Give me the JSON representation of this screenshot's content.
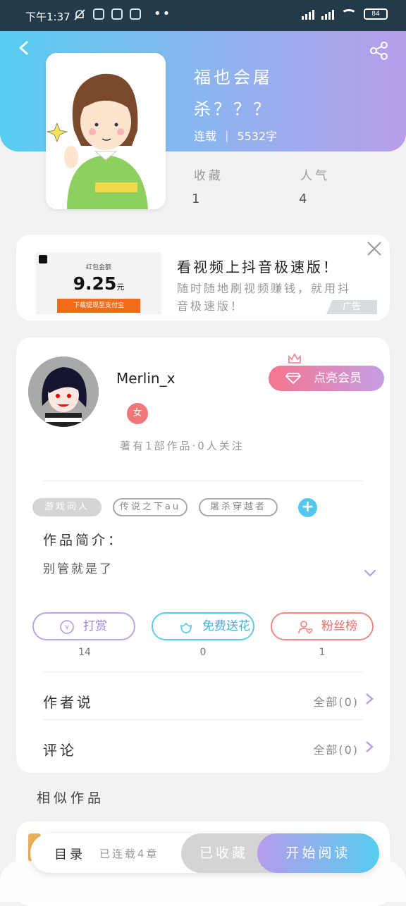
{
  "status_bar": {
    "time": "下午1:37",
    "battery": "84"
  },
  "book": {
    "title": "福也会屠杀？？？",
    "status": "连载",
    "word_count": "5532字",
    "stats": [
      {
        "label": "收藏",
        "value": "1"
      },
      {
        "label": "人气",
        "value": "4"
      }
    ]
  },
  "ad": {
    "image_caption": "红包金额",
    "image_amount": "9.25",
    "image_unit": "元",
    "image_button": "下载提现至支付宝",
    "title": "看视频上抖音极速版！",
    "description": "随时随地刷视频赚钱，就用抖音极速版！",
    "tag": "广告"
  },
  "author": {
    "name": "Merlin_x",
    "vip_label": "点亮会员",
    "gender": "女",
    "stats": "著有1部作品·0人关注"
  },
  "tags": [
    "游戏同人",
    "传说之下au",
    "屠杀穿越者"
  ],
  "intro": {
    "label": "作品简介：",
    "text": "别管就是了"
  },
  "actions": [
    {
      "label": "打赏",
      "value": "14",
      "color": "#b9a4e8"
    },
    {
      "label": "免费送花",
      "value": "0",
      "color": "#5fcbe8"
    },
    {
      "label": "粉丝榜",
      "value": "1",
      "color": "#f08a86"
    }
  ],
  "rows": [
    {
      "label": "作者说",
      "right": "全部(0)"
    },
    {
      "label": "评论",
      "right": "全部(0)"
    }
  ],
  "similar_heading": "相似作品",
  "bottom_bar": {
    "toc": "目录",
    "progress": "已连载4章",
    "favorited": "已收藏",
    "read": "开始阅读"
  }
}
